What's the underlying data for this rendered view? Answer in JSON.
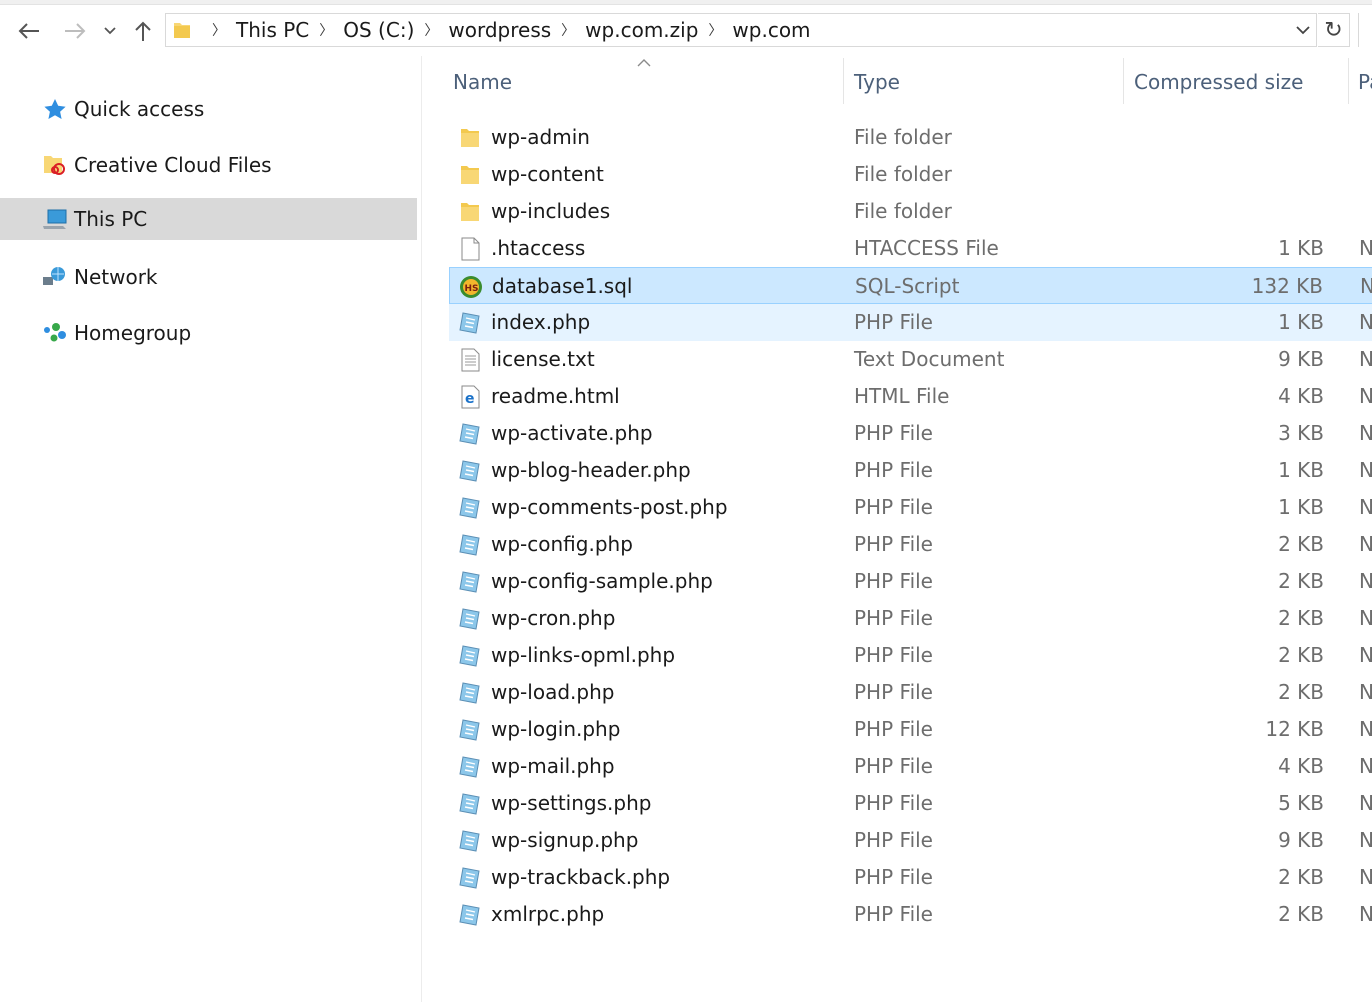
{
  "toolbar": {
    "back_icon": "arrow-left-icon",
    "forward_icon": "arrow-right-icon",
    "recent_icon": "chevron-down-icon",
    "up_icon": "arrow-up-icon",
    "refresh_glyph": "↻"
  },
  "address": {
    "crumbs": [
      "This PC",
      "OS (C:)",
      "wordpress",
      "wp.com.zip",
      "wp.com"
    ]
  },
  "sidebar": {
    "items": [
      {
        "label": "Quick access",
        "icon": "star-icon"
      },
      {
        "label": "Creative Cloud Files",
        "icon": "creative-cloud-folder-icon"
      },
      {
        "label": "This PC",
        "icon": "computer-icon",
        "selected": true
      },
      {
        "label": "Network",
        "icon": "network-icon"
      },
      {
        "label": "Homegroup",
        "icon": "homegroup-icon"
      }
    ]
  },
  "columns": {
    "name": "Name",
    "type": "Type",
    "compressed_size": "Compressed size",
    "truncated": "Pa"
  },
  "files": [
    {
      "name": "wp-admin",
      "type": "File folder",
      "size": "",
      "extra": "",
      "icon": "folder"
    },
    {
      "name": "wp-content",
      "type": "File folder",
      "size": "",
      "extra": "",
      "icon": "folder"
    },
    {
      "name": "wp-includes",
      "type": "File folder",
      "size": "",
      "extra": "",
      "icon": "folder"
    },
    {
      "name": ".htaccess",
      "type": "HTACCESS File",
      "size": "1 KB",
      "extra": "N",
      "icon": "blank"
    },
    {
      "name": "database1.sql",
      "type": "SQL-Script",
      "size": "132 KB",
      "extra": "N",
      "icon": "sql",
      "state": "selected"
    },
    {
      "name": "index.php",
      "type": "PHP File",
      "size": "1 KB",
      "extra": "N",
      "icon": "php",
      "state": "hover"
    },
    {
      "name": "license.txt",
      "type": "Text Document",
      "size": "9 KB",
      "extra": "N",
      "icon": "text"
    },
    {
      "name": "readme.html",
      "type": "HTML File",
      "size": "4 KB",
      "extra": "N",
      "icon": "html"
    },
    {
      "name": "wp-activate.php",
      "type": "PHP File",
      "size": "3 KB",
      "extra": "N",
      "icon": "php"
    },
    {
      "name": "wp-blog-header.php",
      "type": "PHP File",
      "size": "1 KB",
      "extra": "N",
      "icon": "php"
    },
    {
      "name": "wp-comments-post.php",
      "type": "PHP File",
      "size": "1 KB",
      "extra": "N",
      "icon": "php"
    },
    {
      "name": "wp-config.php",
      "type": "PHP File",
      "size": "2 KB",
      "extra": "N",
      "icon": "php"
    },
    {
      "name": "wp-config-sample.php",
      "type": "PHP File",
      "size": "2 KB",
      "extra": "N",
      "icon": "php"
    },
    {
      "name": "wp-cron.php",
      "type": "PHP File",
      "size": "2 KB",
      "extra": "N",
      "icon": "php"
    },
    {
      "name": "wp-links-opml.php",
      "type": "PHP File",
      "size": "2 KB",
      "extra": "N",
      "icon": "php"
    },
    {
      "name": "wp-load.php",
      "type": "PHP File",
      "size": "2 KB",
      "extra": "N",
      "icon": "php"
    },
    {
      "name": "wp-login.php",
      "type": "PHP File",
      "size": "12 KB",
      "extra": "N",
      "icon": "php"
    },
    {
      "name": "wp-mail.php",
      "type": "PHP File",
      "size": "4 KB",
      "extra": "N",
      "icon": "php"
    },
    {
      "name": "wp-settings.php",
      "type": "PHP File",
      "size": "5 KB",
      "extra": "N",
      "icon": "php"
    },
    {
      "name": "wp-signup.php",
      "type": "PHP File",
      "size": "9 KB",
      "extra": "N",
      "icon": "php"
    },
    {
      "name": "wp-trackback.php",
      "type": "PHP File",
      "size": "2 KB",
      "extra": "N",
      "icon": "php"
    },
    {
      "name": "xmlrpc.php",
      "type": "PHP File",
      "size": "2 KB",
      "extra": "N",
      "icon": "php"
    }
  ],
  "colors": {
    "selected_row": "#cce8ff",
    "hover_row": "#e5f3ff",
    "sidebar_selected": "#d9d9d9",
    "header_text": "#4c607a",
    "folder": "#f8d775"
  }
}
